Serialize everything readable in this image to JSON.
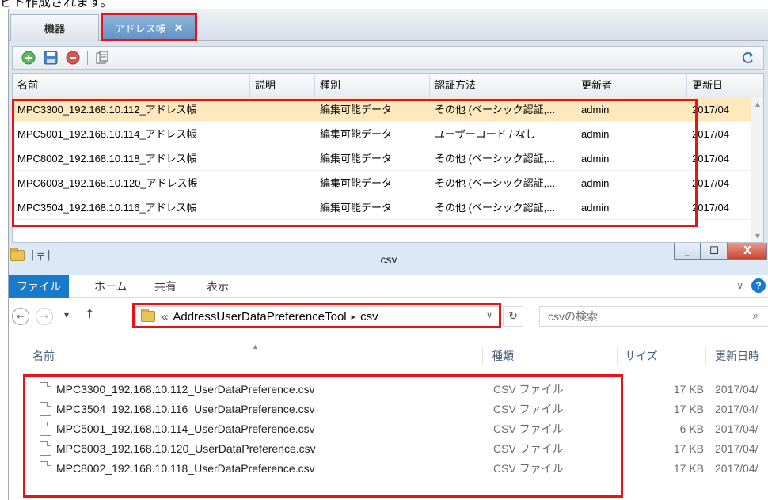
{
  "caption": "ビト作成されます。",
  "app": {
    "tabs": [
      {
        "label": "機器"
      },
      {
        "label": "アドレス帳",
        "close": "✕"
      }
    ],
    "table": {
      "columns": [
        "名前",
        "説明",
        "種別",
        "認証方法",
        "更新者",
        "更新日"
      ],
      "rows": [
        {
          "name": "MPC3300_192.168.10.112_アドレス帳",
          "desc": "",
          "kind": "編集可能データ",
          "auth": "その他 (ベーシック認証,...",
          "updater": "admin",
          "date": "2017/04"
        },
        {
          "name": "MPC5001_192.168.10.114_アドレス帳",
          "desc": "",
          "kind": "編集可能データ",
          "auth": "ユーザーコード / なし",
          "updater": "admin",
          "date": "2017/04"
        },
        {
          "name": "MPC8002_192.168.10.118_アドレス帳",
          "desc": "",
          "kind": "編集可能データ",
          "auth": "その他 (ベーシック認証,...",
          "updater": "admin",
          "date": "2017/04"
        },
        {
          "name": "MPC6003_192.168.10.120_アドレス帳",
          "desc": "",
          "kind": "編集可能データ",
          "auth": "その他 (ベーシック認証,...",
          "updater": "admin",
          "date": "2017/04"
        },
        {
          "name": "MPC3504_192.168.10.116_アドレス帳",
          "desc": "",
          "kind": "編集可能データ",
          "auth": "その他 (ベーシック認証,...",
          "updater": "admin",
          "date": "2017/04"
        }
      ]
    },
    "colors": {
      "selected_row": "#fde9bd",
      "highlight": "#e8121a",
      "active_tab": "#5f8fc4"
    }
  },
  "explorer": {
    "title": "csv",
    "title_sep": "| ╤ |",
    "window_buttons": {
      "minimize": "_",
      "maximize": "☐",
      "close": "X"
    },
    "ribbon": {
      "file": "ファイル",
      "home": "ホーム",
      "share": "共有",
      "view": "表示",
      "expand": "∨",
      "help": "?"
    },
    "nav": {
      "back": "←",
      "forward": "→",
      "recent": "▾",
      "up": "↑"
    },
    "address": {
      "prefix": "«",
      "parent": "AddressUserDataPreferenceTool",
      "sep": "▸",
      "current": "csv",
      "dropdown": "∨",
      "refresh": "↻"
    },
    "search": {
      "placeholder": "csvの検索",
      "icon": "⌕"
    },
    "columns": {
      "name": "名前",
      "type": "種類",
      "size": "サイズ",
      "date": "更新日時"
    },
    "files": [
      {
        "name": "MPC3300_192.168.10.112_UserDataPreference.csv",
        "type": "CSV ファイル",
        "size": "17 KB",
        "date": "2017/04/"
      },
      {
        "name": "MPC3504_192.168.10.116_UserDataPreference.csv",
        "type": "CSV ファイル",
        "size": "17 KB",
        "date": "2017/04/"
      },
      {
        "name": "MPC5001_192.168.10.114_UserDataPreference.csv",
        "type": "CSV ファイル",
        "size": "6 KB",
        "date": "2017/04/"
      },
      {
        "name": "MPC6003_192.168.10.120_UserDataPreference.csv",
        "type": "CSV ファイル",
        "size": "17 KB",
        "date": "2017/04/"
      },
      {
        "name": "MPC8002_192.168.10.118_UserDataPreference.csv",
        "type": "CSV ファイル",
        "size": "17 KB",
        "date": "2017/04/"
      }
    ],
    "colors": {
      "ribbon_file": "#1979ca",
      "titlebar": "#dbe8f6"
    }
  }
}
